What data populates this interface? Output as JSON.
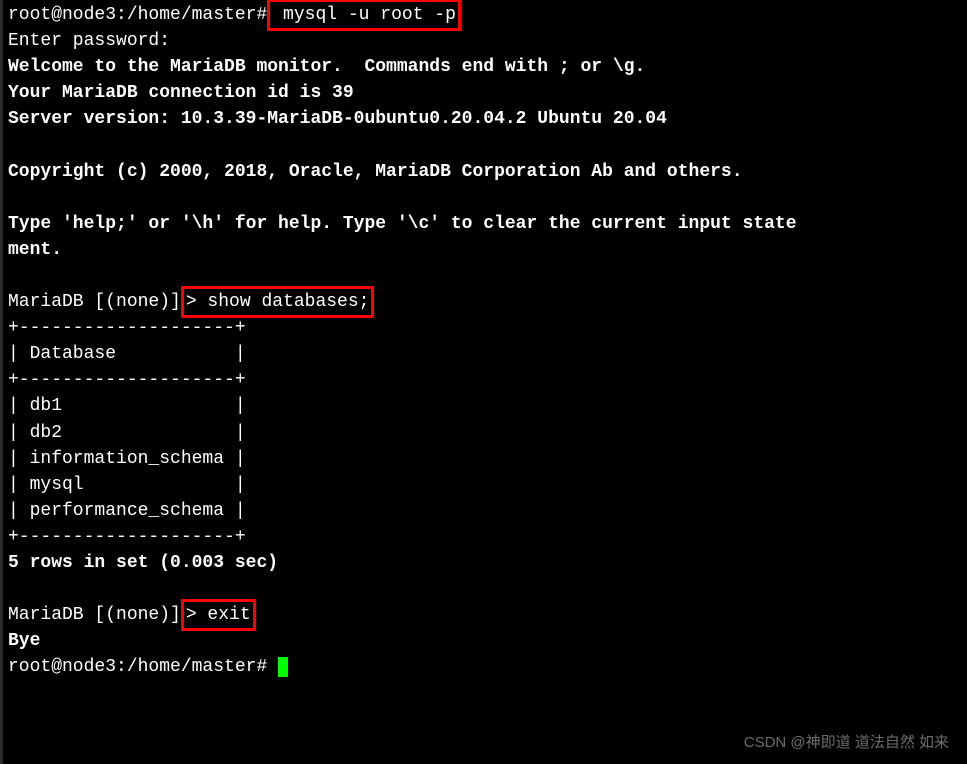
{
  "line1": {
    "prompt": "root@node3:/home/master#",
    "cmd": " mysql -u root -p"
  },
  "line2": "Enter password:",
  "line3": "Welcome to the MariaDB monitor.  Commands end with ; or \\g.",
  "line4": "Your MariaDB connection id is 39",
  "line5": "Server version: 10.3.39-MariaDB-0ubuntu0.20.04.2 Ubuntu 20.04",
  "line6": "Copyright (c) 2000, 2018, Oracle, MariaDB Corporation Ab and others.",
  "line7a": "Type 'help;' or '\\h' for help. Type '\\c' to clear the current input state",
  "line7b": "ment.",
  "maria_prompt1_a": "MariaDB [(none)]",
  "maria_prompt1_b": "> show databases;",
  "table": {
    "border": "+--------------------+",
    "header": "| Database           |",
    "rows": [
      "| db1                |",
      "| db2                |",
      "| information_schema |",
      "| mysql              |",
      "| performance_schema |"
    ]
  },
  "result_summary": "5 rows in set (0.003 sec)",
  "maria_prompt2_a": "MariaDB [(none)]",
  "maria_prompt2_b": "> exit",
  "bye": "Bye",
  "final_prompt": "root@node3:/home/master#",
  "watermark": "CSDN @神即道 道法自然 如来"
}
